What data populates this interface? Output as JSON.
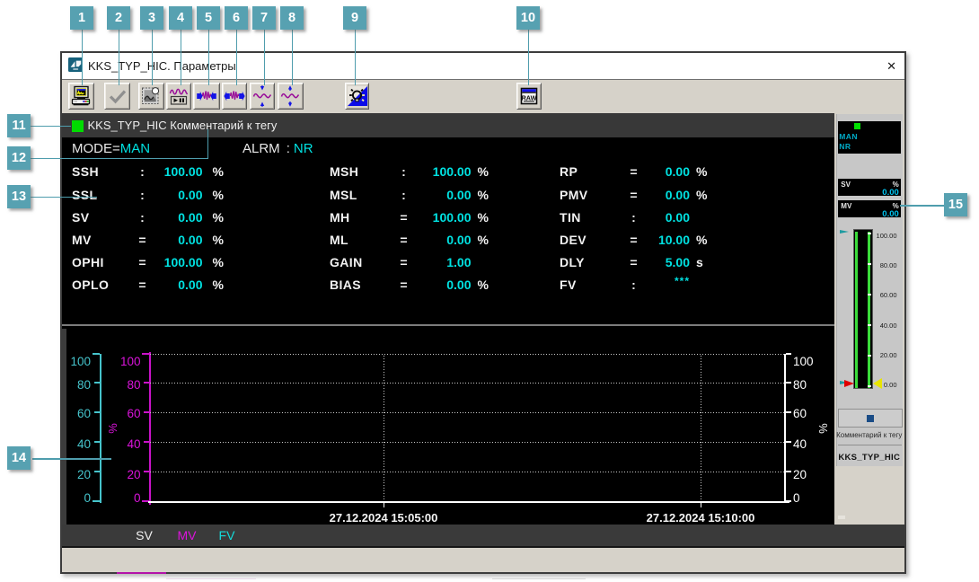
{
  "callouts": {
    "badge_color": "#57A1B1",
    "labels": [
      "1",
      "2",
      "3",
      "4",
      "5",
      "6",
      "7",
      "8",
      "9",
      "10",
      "11",
      "12",
      "13",
      "14",
      "15"
    ]
  },
  "window": {
    "title": "KKS_TYP_HIC. Параметры",
    "close_glyph": "✕"
  },
  "toolbar": {
    "buttons": [
      {
        "name": "print-report",
        "icon": "print-screen-icon"
      },
      {
        "name": "accept",
        "icon": "checkmark-icon"
      },
      {
        "name": "snapshot",
        "icon": "picture-icon"
      },
      {
        "name": "pause-trend",
        "icon": "trend-play-pause-icon"
      },
      {
        "name": "zoom-in-time",
        "icon": "wave-compress-horizontal-icon"
      },
      {
        "name": "zoom-out-time",
        "icon": "wave-expand-horizontal-icon"
      },
      {
        "name": "zoom-in-value",
        "icon": "wave-compress-vertical-icon"
      },
      {
        "name": "zoom-out-value",
        "icon": "wave-expand-vertical-icon"
      },
      {
        "name": "color-settings",
        "icon": "color-scheme-icon"
      },
      {
        "name": "raw-data",
        "icon": "raw-window-icon",
        "icon_text": "RAW"
      }
    ]
  },
  "params": {
    "indicator_color": "#00DC00",
    "tag_header": "KKS_TYP_HIC Комментарий к тегу",
    "mode_label": "MODE=",
    "mode_value": "MAN",
    "alarm_label": "ALRM",
    "alarm_sep": ":",
    "alarm_value": "NR",
    "columns": [
      {
        "rows": [
          {
            "name": "SSH",
            "sep": ":",
            "value": "100.00",
            "unit": "%"
          },
          {
            "name": "SSL",
            "sep": ":",
            "value": "0.00",
            "unit": "%"
          },
          {
            "name": "SV",
            "sep": ":",
            "value": "0.00",
            "unit": "%"
          },
          {
            "name": "MV",
            "sep": "=",
            "value": "0.00",
            "unit": "%"
          },
          {
            "name": "OPHI",
            "sep": "=",
            "value": "100.00",
            "unit": "%"
          },
          {
            "name": "OPLO",
            "sep": "=",
            "value": "0.00",
            "unit": "%"
          }
        ]
      },
      {
        "rows": [
          {
            "name": "MSH",
            "sep": ":",
            "value": "100.00",
            "unit": "%"
          },
          {
            "name": "MSL",
            "sep": ":",
            "value": "0.00",
            "unit": "%"
          },
          {
            "name": "MH",
            "sep": "=",
            "value": "100.00",
            "unit": "%"
          },
          {
            "name": "ML",
            "sep": "=",
            "value": "0.00",
            "unit": "%"
          },
          {
            "name": "GAIN",
            "sep": "=",
            "value": "1.00",
            "unit": ""
          },
          {
            "name": "BIAS",
            "sep": "=",
            "value": "0.00",
            "unit": "%"
          }
        ]
      },
      {
        "rows": [
          {
            "name": "RP",
            "sep": "=",
            "value": "0.00",
            "unit": "%"
          },
          {
            "name": "PMV",
            "sep": "=",
            "value": "0.00",
            "unit": "%"
          },
          {
            "name": "TIN",
            "sep": ":",
            "value": "0.00",
            "unit": ""
          },
          {
            "name": "DEV",
            "sep": "=",
            "value": "10.00",
            "unit": "%"
          },
          {
            "name": "DLY",
            "sep": "=",
            "value": "5.00",
            "unit": "s"
          },
          {
            "name": "FV",
            "sep": ":",
            "value": "***",
            "unit": ""
          }
        ]
      }
    ]
  },
  "trend": {
    "axis_fv": {
      "color": "#46C4CC",
      "ticks": [
        "100",
        "80",
        "60",
        "40",
        "20",
        "0"
      ]
    },
    "axis_mv": {
      "color": "#DC14DC",
      "unit": "%",
      "ticks": [
        "100",
        "80",
        "60",
        "40",
        "20",
        "0"
      ]
    },
    "axis_right": {
      "color": "#FFFFFF",
      "unit": "%",
      "ticks": [
        "100",
        "80",
        "60",
        "40",
        "20",
        "0"
      ]
    },
    "x_labels": [
      "27.12.2024 15:05:00",
      "27.12.2024 15:10:00"
    ],
    "legend": [
      {
        "label": "SV",
        "color": "#F0F0F0"
      },
      {
        "label": "MV",
        "color": "#DC14DC"
      },
      {
        "label": "FV",
        "color": "#14DCDC"
      }
    ]
  },
  "chart_data": {
    "type": "line",
    "title": "",
    "xlabel": "",
    "ylabel": "%",
    "ylim": [
      0,
      100
    ],
    "x_ticks": [
      "27.12.2024 15:05:00",
      "27.12.2024 15:10:00"
    ],
    "y_ticks": [
      100,
      80,
      60,
      40,
      20,
      0
    ],
    "grid": true,
    "legend_position": "bottom",
    "series": [
      {
        "name": "SV",
        "color": "#F0F0F0",
        "values": []
      },
      {
        "name": "MV",
        "color": "#DC14DC",
        "values": []
      },
      {
        "name": "FV",
        "color": "#14DCDC",
        "values": []
      }
    ]
  },
  "faceplate": {
    "mode_value": "MAN",
    "alarm_value": "NR",
    "sv": {
      "label": "SV",
      "unit": "%",
      "value": "0.00"
    },
    "mv": {
      "label": "MV",
      "unit": "%",
      "value": "0.00"
    },
    "gauge": {
      "scale": [
        "100.00",
        "80.00",
        "60.00",
        "40.00",
        "20.00",
        "0.00"
      ]
    },
    "comment": "Комментарий к тегу",
    "tag": "KKS_TYP_HIC"
  },
  "status_bar": {
    "text": ""
  }
}
